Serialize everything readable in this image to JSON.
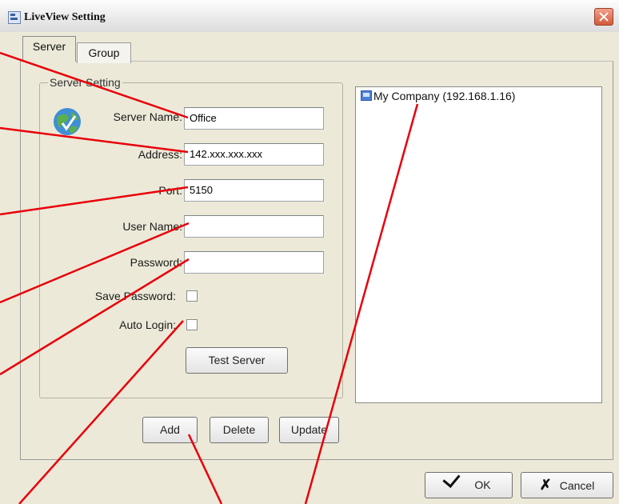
{
  "window": {
    "title": "LiveView Setting"
  },
  "tabs": [
    {
      "label": "Server",
      "active": true
    },
    {
      "label": "Group",
      "active": false
    }
  ],
  "server_setting": {
    "group_label": "Server Setting",
    "fields": [
      {
        "label": "Server Name:",
        "value": "Office"
      },
      {
        "label": "Address:",
        "value": "142.xxx.xxx.xxx"
      },
      {
        "label": "Port:",
        "value": "5150"
      },
      {
        "label": "User Name:",
        "value": ""
      },
      {
        "label": "Password:",
        "value": ""
      }
    ],
    "save_password": {
      "label": "Save Password:",
      "checked": false
    },
    "auto_login": {
      "label": "Auto Login:",
      "checked": false
    },
    "test_button": "Test Server"
  },
  "actions": {
    "add": "Add",
    "delete": "Delete",
    "update": "Update"
  },
  "server_list": [
    {
      "label": "My Company (192.168.1.16)",
      "icon": "server-icon"
    }
  ],
  "footer": {
    "ok": "OK",
    "cancel": "Cancel"
  },
  "colors": {
    "annotation": "#e8000b",
    "close_button": "#d45a3a"
  }
}
